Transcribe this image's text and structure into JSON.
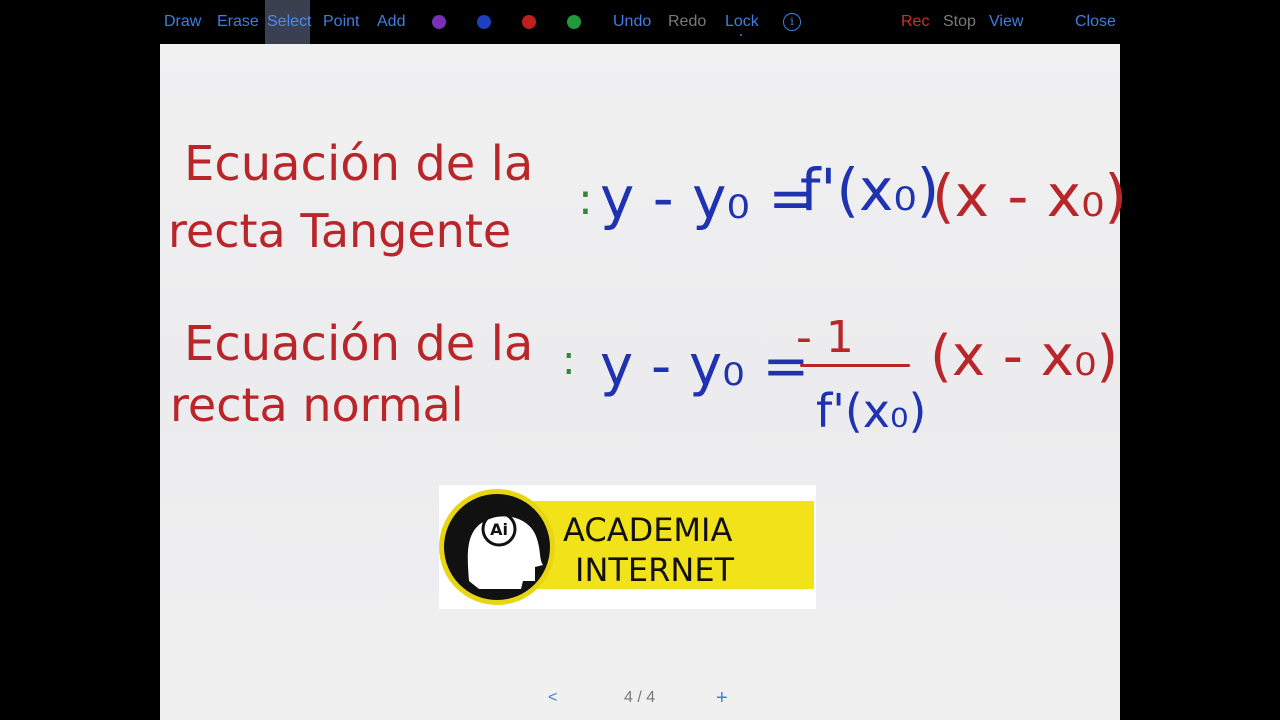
{
  "toolbar": {
    "draw": "Draw",
    "erase": "Erase",
    "select": "Select",
    "point": "Point",
    "add": "Add",
    "undo": "Undo",
    "redo": "Redo",
    "lock": "Lock",
    "info": "i",
    "rec": "Rec",
    "stop": "Stop",
    "view": "View",
    "close": "Close",
    "colors": [
      "#7a2fb8",
      "#1e3fc0",
      "#c0201d",
      "#1f9a3a"
    ]
  },
  "board": {
    "tangent": {
      "label_line1": "Ecuación de la",
      "label_line2": "recta Tangente",
      "colon": ":",
      "formula_lhs": "y - y₀ =",
      "formula_fp": "f'(x₀)",
      "formula_paren": "(x - x₀)"
    },
    "normal": {
      "label_line1": "Ecuación de la",
      "label_line2": "recta normal",
      "colon": ":",
      "formula_lhs": "y - y₀ =",
      "numerator": "- 1",
      "denominator": "f'(x₀)",
      "formula_paren": "(x - x₀)"
    }
  },
  "logo": {
    "badge": "Ai",
    "line1": "ACADEMIA",
    "line2": "INTERNET"
  },
  "pager": {
    "prev": "<",
    "page": "4 / 4",
    "add": "+"
  }
}
